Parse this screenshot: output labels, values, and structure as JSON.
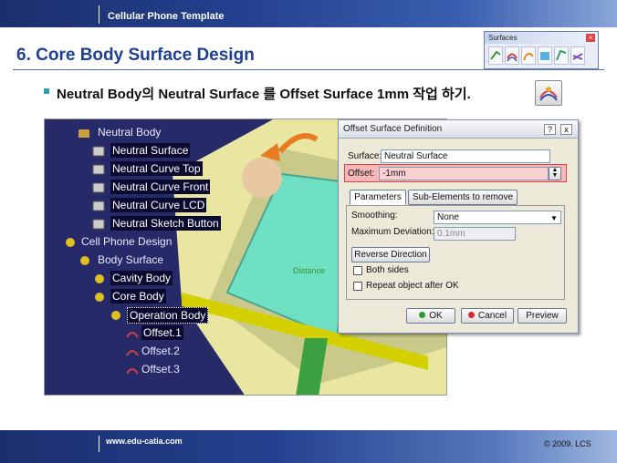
{
  "header": {
    "title": "Cellular Phone Template"
  },
  "slide": {
    "heading": "6. Core Body Surface Design",
    "instruction": "Neutral Body의 Neutral Surface 를 Offset Surface 1mm 작업 하기."
  },
  "toolbar": {
    "title": "Surfaces",
    "icons": [
      "extrude-icon",
      "offset-icon",
      "sweep-icon",
      "fill-icon",
      "loft-icon",
      "blend-icon"
    ]
  },
  "tree": {
    "items": [
      {
        "label": "Neutral Body"
      },
      {
        "label": "Neutral Surface"
      },
      {
        "label": "Neutral Curve Top"
      },
      {
        "label": "Neutral Curve Front"
      },
      {
        "label": "Neutral Curve LCD"
      },
      {
        "label": "Neutral Sketch Button"
      },
      {
        "label": "Cell Phone Design"
      },
      {
        "label": "Body Surface"
      },
      {
        "label": "Cavity Body"
      },
      {
        "label": "Core Body"
      },
      {
        "label": "Operation Body"
      },
      {
        "label": "Offset.1"
      },
      {
        "label": "Offset.2"
      },
      {
        "label": "Offset.3"
      }
    ]
  },
  "viewport": {
    "distance_label": "Distance"
  },
  "dialog": {
    "title": "Offset Surface Definition",
    "surface_label": "Surface:",
    "surface_value": "Neutral Surface",
    "offset_label": "Offset:",
    "offset_value": "-1mm",
    "tabs": [
      "Parameters",
      "Sub-Elements to remove"
    ],
    "smoothing_label": "Smoothing:",
    "smoothing_value": "None",
    "maxdev_label": "Maximum Deviation:",
    "maxdev_value": "0.1mm",
    "reverse_label": "Reverse Direction",
    "both_sides_label": "Both sides",
    "repeat_label": "Repeat object after OK",
    "ok_label": "OK",
    "cancel_label": "Cancel",
    "preview_label": "Preview",
    "help_glyph": "?",
    "close_glyph": "x"
  },
  "footer": {
    "url": "www.edu-catia.com",
    "copyright": "© 2009. LCS"
  }
}
